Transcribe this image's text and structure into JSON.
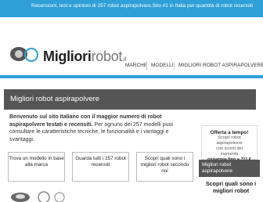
{
  "topbar": {
    "text": "Recensioni, test e opinioni di 257 robot aspirapolvere.Sito #1 in Italia per quantità di robot recensiti"
  },
  "logo": {
    "brand_bold": "Migliori",
    "brand_light": "robot",
    "suffix": ".it"
  },
  "nav": {
    "items": [
      "MARCHE",
      "MODELLI",
      "MIGLIORI ROBOT ASPIRAPOLVERE"
    ]
  },
  "page_title": "Migliori robot aspirapolvere",
  "intro": {
    "bold": "Benvenuto sul sito italiano con il maggior numero di robot aspirapolvere testati e recensiti.",
    "rest": " Per ognuno dei 257 modelli puoi consultare le caratteristiche tecniche, le funzionalità e i vantaggi e svantaggi."
  },
  "boxes": [
    {
      "label": "Trova un modello in base alla marca"
    },
    {
      "label": "Guarda tutti i 257 robot recensiti"
    },
    {
      "label": "Scopri quali sono i migliori robot secondo noi"
    }
  ],
  "offer": {
    "title": "Offerta a tempo!",
    "line1": "Scopri robot",
    "line2": "aspirapolvere",
    "line3": "con sconti del",
    "line4": "momento",
    "price": "risparmia fino a 711 €"
  },
  "sidebar": {
    "link": "Migliori robot aspirapolvere",
    "teaser": "Scopri quali sono i migliori robot"
  }
}
